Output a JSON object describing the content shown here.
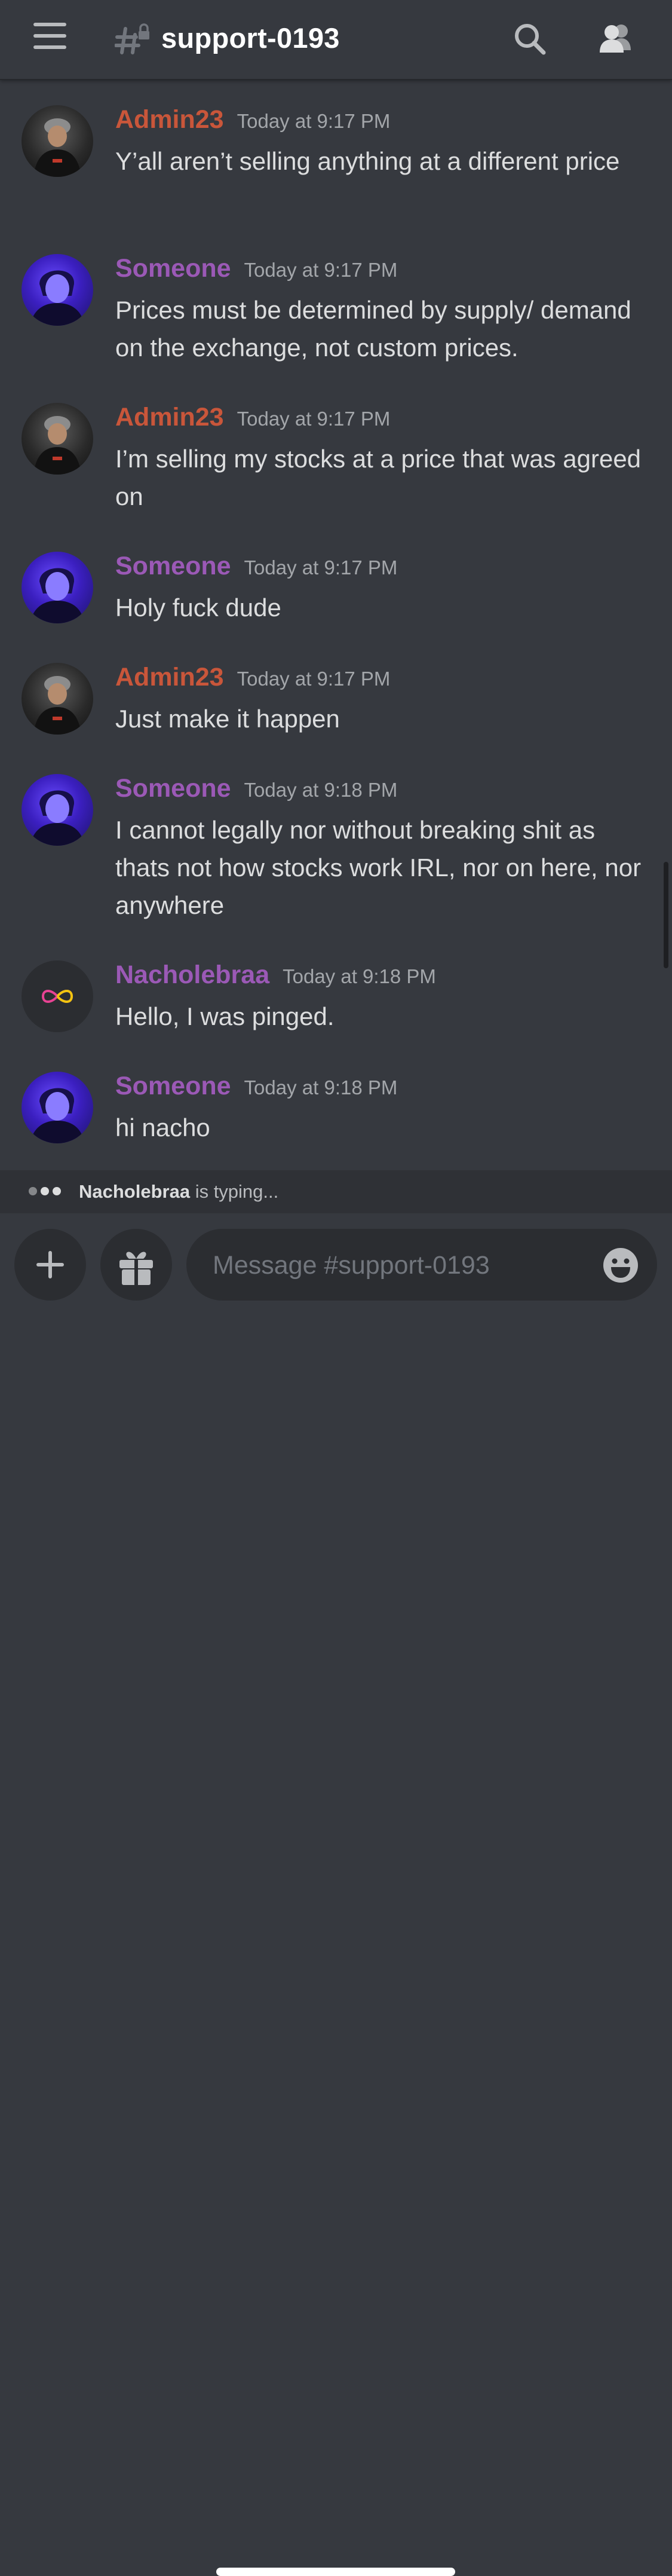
{
  "header": {
    "channel_name": "support-0193",
    "menu_icon": "hamburger-menu-icon",
    "channel_icon": "locked-hash-channel-icon",
    "search_icon": "search-icon",
    "members_icon": "members-icon"
  },
  "messages": [
    {
      "author": "Admin23",
      "time": "Today at 9:17 PM",
      "text": "Y’all aren’t selling anything at a different price"
    },
    {
      "author": "Someone",
      "time": "Today at 9:17 PM",
      "text": "Prices must be determined by supply/ demand on the exchange, not custom prices."
    },
    {
      "author": "Admin23",
      "time": "Today at 9:17 PM",
      "text": "I’m selling my stocks at a price that was agreed on"
    },
    {
      "author": "Someone",
      "time": "Today at 9:17 PM",
      "text": "Holy fuck dude"
    },
    {
      "author": "Admin23",
      "time": "Today at 9:17 PM",
      "text": "Just make it happen"
    },
    {
      "author": "Someone",
      "time": "Today at 9:18 PM",
      "text": "I cannot legally nor without breaking shit as thats not how stocks work IRL, nor on here, nor anywhere"
    },
    {
      "author": "Nacholebraa",
      "time": "Today at 9:18 PM",
      "text": "Hello, I was pinged."
    },
    {
      "author": "Someone",
      "time": "Today at 9:18 PM",
      "text": "hi nacho"
    }
  ],
  "typing": {
    "user": "Nacholebraa",
    "suffix": " is typing..."
  },
  "composer": {
    "placeholder": "Message #support-0193",
    "plus_icon": "plus-icon",
    "gift_icon": "gift-icon",
    "emoji_icon": "emoji-icon"
  },
  "colors": {
    "background": "#36393f",
    "admin_name": "#c9563a",
    "someone_name": "#9b59b6",
    "text": "#dcddde"
  }
}
